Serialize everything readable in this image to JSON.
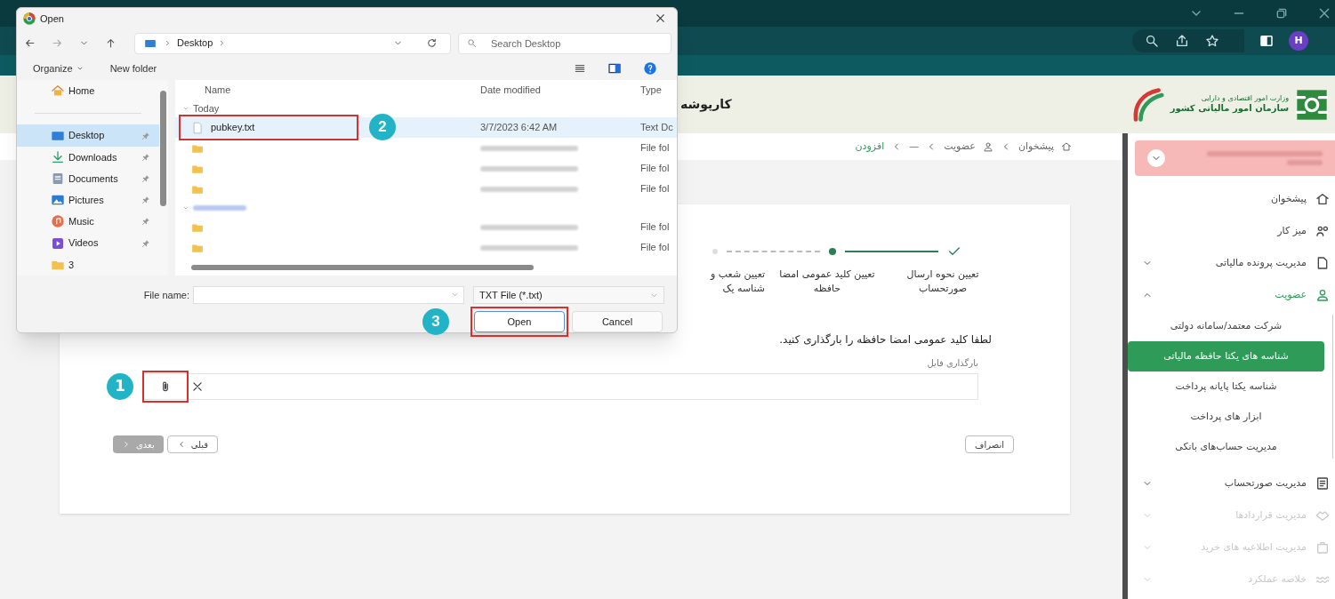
{
  "browser": {
    "profile_initial": "H"
  },
  "header": {
    "title": "کارپوشه",
    "logo_lines": [
      "وزارت امور اقتصادی و دارایی",
      "سازمان امور مالیاتی کشور"
    ]
  },
  "breadcrumb": [
    {
      "label": "پیشخوان",
      "current": false
    },
    {
      "label": "عضویت",
      "current": false
    },
    {
      "label": "—",
      "current": false
    },
    {
      "label": "افزودن",
      "current": true
    }
  ],
  "sidebar": {
    "items": [
      {
        "label": "پیشخوان",
        "disabled": false
      },
      {
        "label": "میز کار",
        "disabled": false
      },
      {
        "label": "مدیریت پرونده مالیاتی",
        "expanded": false,
        "disabled": false
      },
      {
        "label": "عضویت",
        "expanded": true,
        "disabled": false,
        "children": [
          {
            "label": "شرکت معتمد/سامانه دولتی",
            "selected": false
          },
          {
            "label": "شناسه های یکتا حافظه مالیاتی",
            "selected": true
          },
          {
            "label": "شناسه یکتا پایانه پرداخت",
            "selected": false
          },
          {
            "label": "ابزار های پرداخت",
            "selected": false
          },
          {
            "label": "مدیریت حساب‌های بانکی",
            "selected": false
          }
        ]
      },
      {
        "label": "مدیریت صورتحساب",
        "expanded": false,
        "disabled": false
      },
      {
        "label": "مدیریت قراردادها",
        "expanded": false,
        "disabled": true
      },
      {
        "label": "مدیریت اطلاعیه های خرید",
        "expanded": false,
        "disabled": true
      },
      {
        "label": "خلاصه عملکرد",
        "expanded": false,
        "disabled": true
      }
    ]
  },
  "stepper": {
    "steps": [
      {
        "label": "تعیین نحوه ارسال صورتحساب",
        "done": true,
        "current": false
      },
      {
        "label": "تعیین کلید عمومی امضا حافظه",
        "done": false,
        "current": true
      },
      {
        "label": "تعیین شعب و شناسه یک",
        "done": false,
        "current": false
      }
    ]
  },
  "form": {
    "instruction": "لطفا کلید عمومی امضا حافظه را بارگذاری کنید.",
    "field_label": "بارگذاری فایل",
    "actions": [
      {
        "label": "انصراف",
        "kind": "cancel",
        "disabled": false
      },
      {
        "label": "قبلی",
        "kind": "prev",
        "disabled": false
      },
      {
        "label": "بعدی",
        "kind": "next",
        "disabled": true
      }
    ]
  },
  "dialog": {
    "title": "Open",
    "path": [
      "Desktop"
    ],
    "search_placeholder": "Search Desktop",
    "toolbar": {
      "organize": "Organize",
      "new_folder": "New folder"
    },
    "nav": [
      {
        "label": "Home",
        "selected": false,
        "pinned": false
      },
      {
        "label": "Desktop",
        "selected": true,
        "pinned": true
      },
      {
        "label": "Downloads",
        "selected": false,
        "pinned": true
      },
      {
        "label": "Documents",
        "selected": false,
        "pinned": true
      },
      {
        "label": "Pictures",
        "selected": false,
        "pinned": true
      },
      {
        "label": "Music",
        "selected": false,
        "pinned": true
      },
      {
        "label": "Videos",
        "selected": false,
        "pinned": true
      },
      {
        "label": "3",
        "selected": false,
        "pinned": false
      }
    ],
    "columns": {
      "name": "Name",
      "date_modified": "Date modified",
      "type": "Type"
    },
    "groups": [
      {
        "label": "Today",
        "rows": [
          {
            "kind": "file",
            "name": "pubkey.txt",
            "date": "3/7/2023 6:42 AM",
            "type": "Text Dc",
            "selected": true
          },
          {
            "kind": "folder",
            "type": "File fol",
            "selected": false
          },
          {
            "kind": "folder",
            "type": "File fol",
            "selected": false
          },
          {
            "kind": "folder",
            "type": "File fol",
            "selected": false
          }
        ]
      },
      {
        "rows": [
          {
            "kind": "folder",
            "type": "File fol",
            "selected": false
          },
          {
            "kind": "folder",
            "type": "File fol",
            "selected": false
          }
        ]
      }
    ],
    "file_name_label": "File name:",
    "file_type": "TXT File (*.txt)",
    "buttons": {
      "open": "Open",
      "cancel": "Cancel"
    }
  },
  "annotations": [
    "1",
    "2",
    "3"
  ]
}
